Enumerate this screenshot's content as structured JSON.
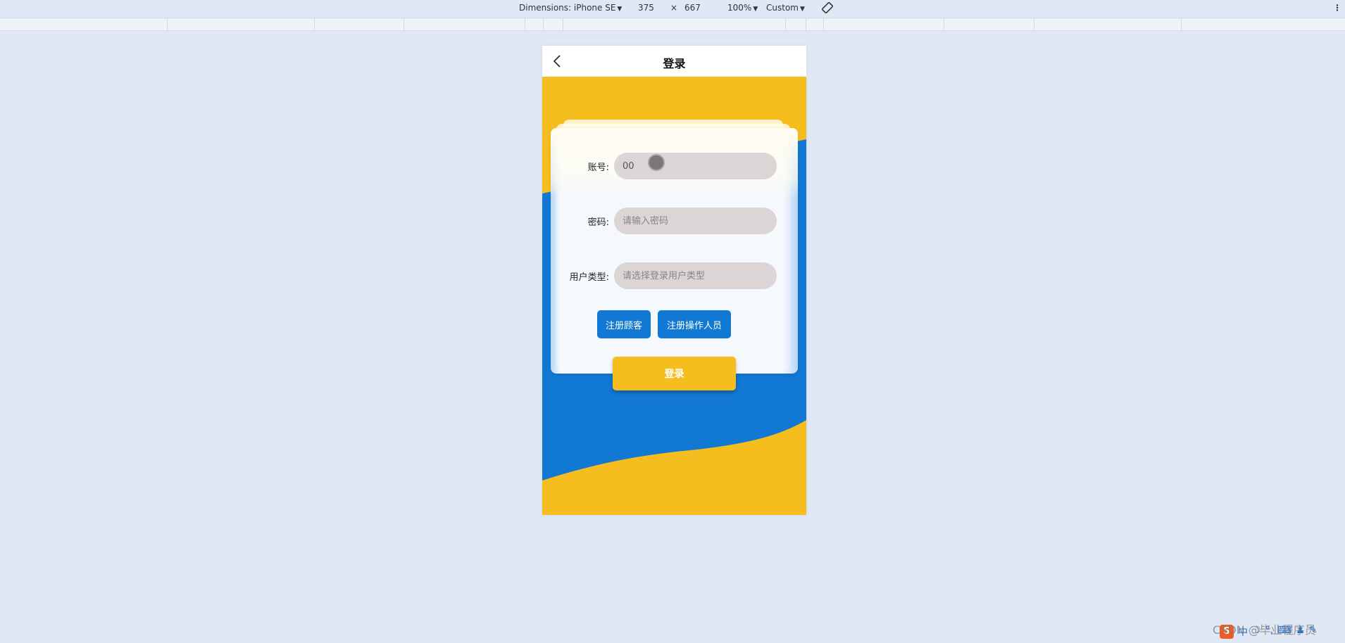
{
  "devtools": {
    "dimensions_label": "Dimensions: iPhone SE",
    "width": "375",
    "times": "×",
    "height": "667",
    "zoom": "100%",
    "throttle": "Custom",
    "rotate_icon": "rotate-icon",
    "more_icon": "⋮"
  },
  "page": {
    "title": "登录",
    "back_icon": "chevron-left-icon",
    "colors": {
      "yellow": "#f6bd1f",
      "blue": "#1178d4",
      "input_bg": "#dcd5d5"
    },
    "form": {
      "account_label": "账号:",
      "account_value": "00",
      "password_label": "密码:",
      "password_placeholder": "请输入密码",
      "user_type_label": "用户类型:",
      "user_type_placeholder": "请选择登录用户类型"
    },
    "buttons": {
      "register_customer": "注册顾客",
      "register_operator": "注册操作人员",
      "login": "登录"
    }
  },
  "watermark": "CSDN @毕业程序员",
  "tray": {
    "logo": "S",
    "ime": "中"
  }
}
